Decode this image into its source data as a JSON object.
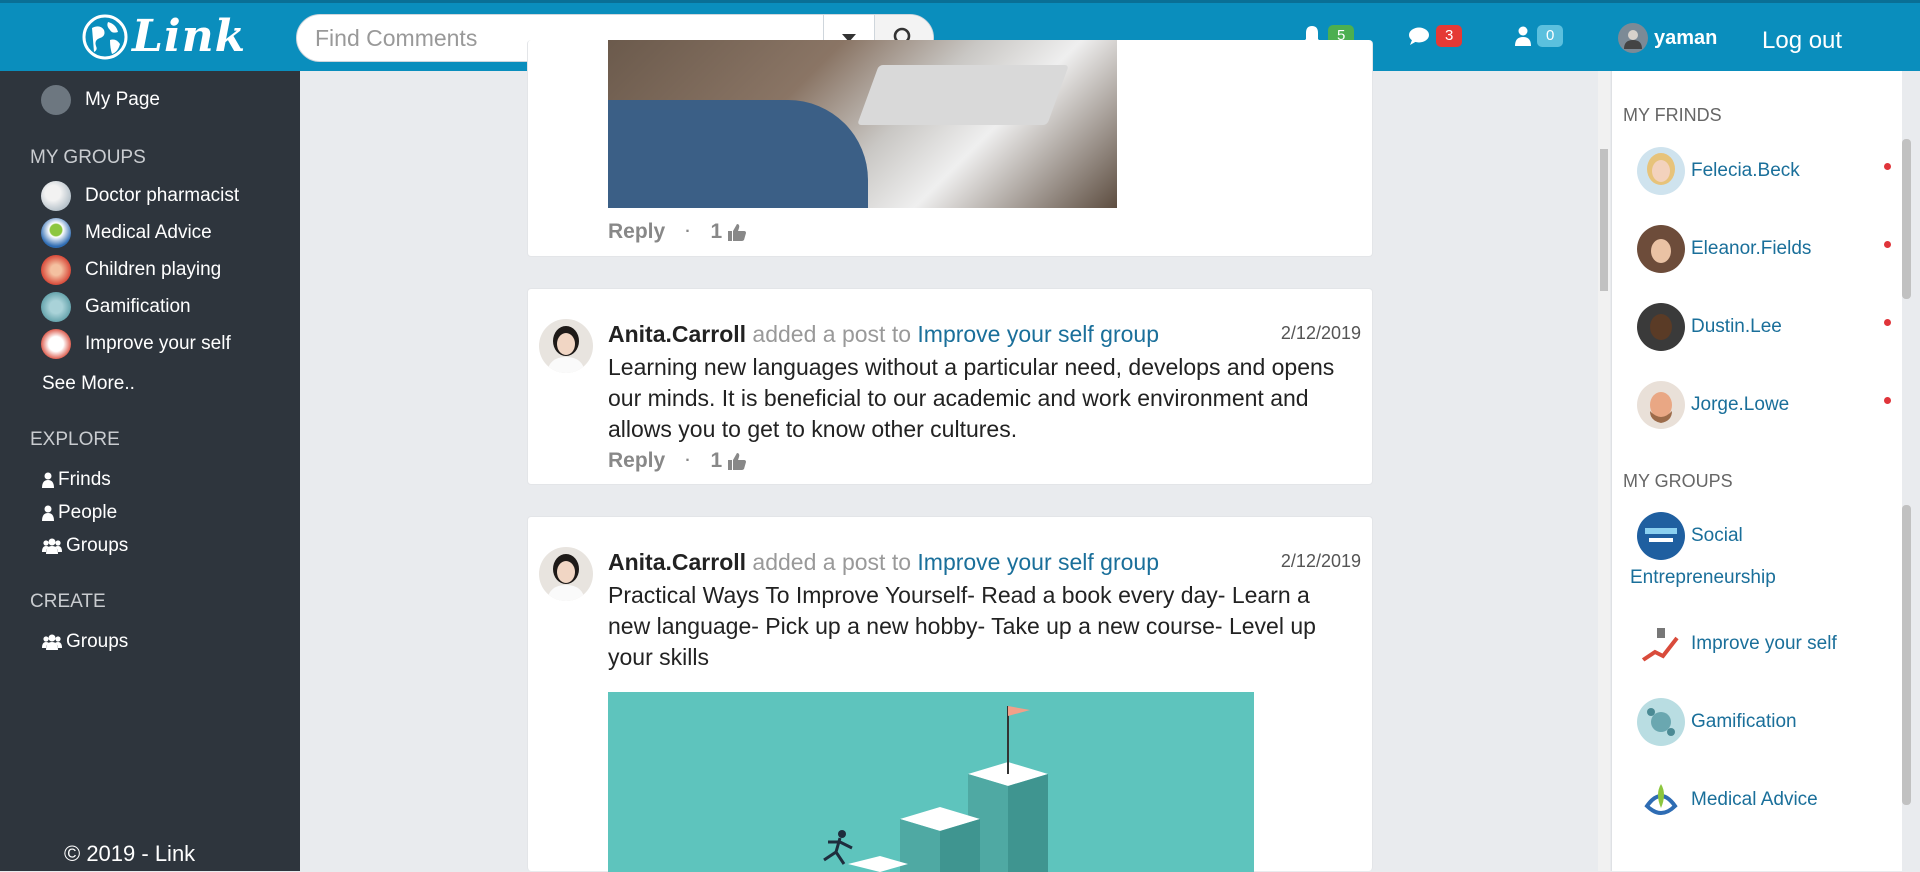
{
  "header": {
    "logo_text": "Link",
    "search_placeholder": "Find Comments",
    "notifications_count": "5",
    "messages_count": "3",
    "friend_requests_count": "0",
    "username": "yaman",
    "logout_label": "Log out",
    "colors": {
      "bar": "#0a8ebd",
      "badge_green": "#4caf50",
      "badge_red": "#e53935",
      "badge_blue": "#5bc0de"
    }
  },
  "sidebar": {
    "my_page": "My Page",
    "groups_heading": "MY GROUPS",
    "groups": [
      "Doctor pharmacist",
      "Medical Advice",
      "Children playing",
      "Gamification",
      "Improve your self"
    ],
    "see_more": "See More..",
    "explore_heading": "EXPLORE",
    "explore": [
      "Frinds",
      "People",
      "Groups"
    ],
    "create_heading": "CREATE",
    "create": [
      "Groups"
    ],
    "copyright": "© 2019 - Link"
  },
  "feed": {
    "reply_label": "Reply",
    "separator": "·",
    "posts": [
      {
        "likes": "1"
      },
      {
        "author": "Anita.Carroll",
        "action": "added a post to",
        "group": "Improve your self group",
        "date": "2/12/2019",
        "text": "Learning new languages without a particular need, develops and opens our minds. It is beneficial to our academic and work environment and allows you to get to know other cultures.",
        "likes": "1"
      },
      {
        "author": "Anita.Carroll",
        "action": "added a post to",
        "group": "Improve your self group",
        "date": "2/12/2019",
        "text": "Practical Ways To Improve Yourself- Read a book every day- Learn a new language- Pick up a new hobby- Take up a new course- Level up your skills"
      }
    ]
  },
  "rightbar": {
    "friends_heading": "MY FRINDS",
    "friends": [
      "Felecia.Beck",
      "Eleanor.Fields",
      "Dustin.Lee",
      "Jorge.Lowe"
    ],
    "groups_heading": "MY GROUPS",
    "groups": [
      "Social",
      "Entrepreneurship",
      "Improve your self",
      "Gamification",
      "Medical Advice"
    ]
  }
}
